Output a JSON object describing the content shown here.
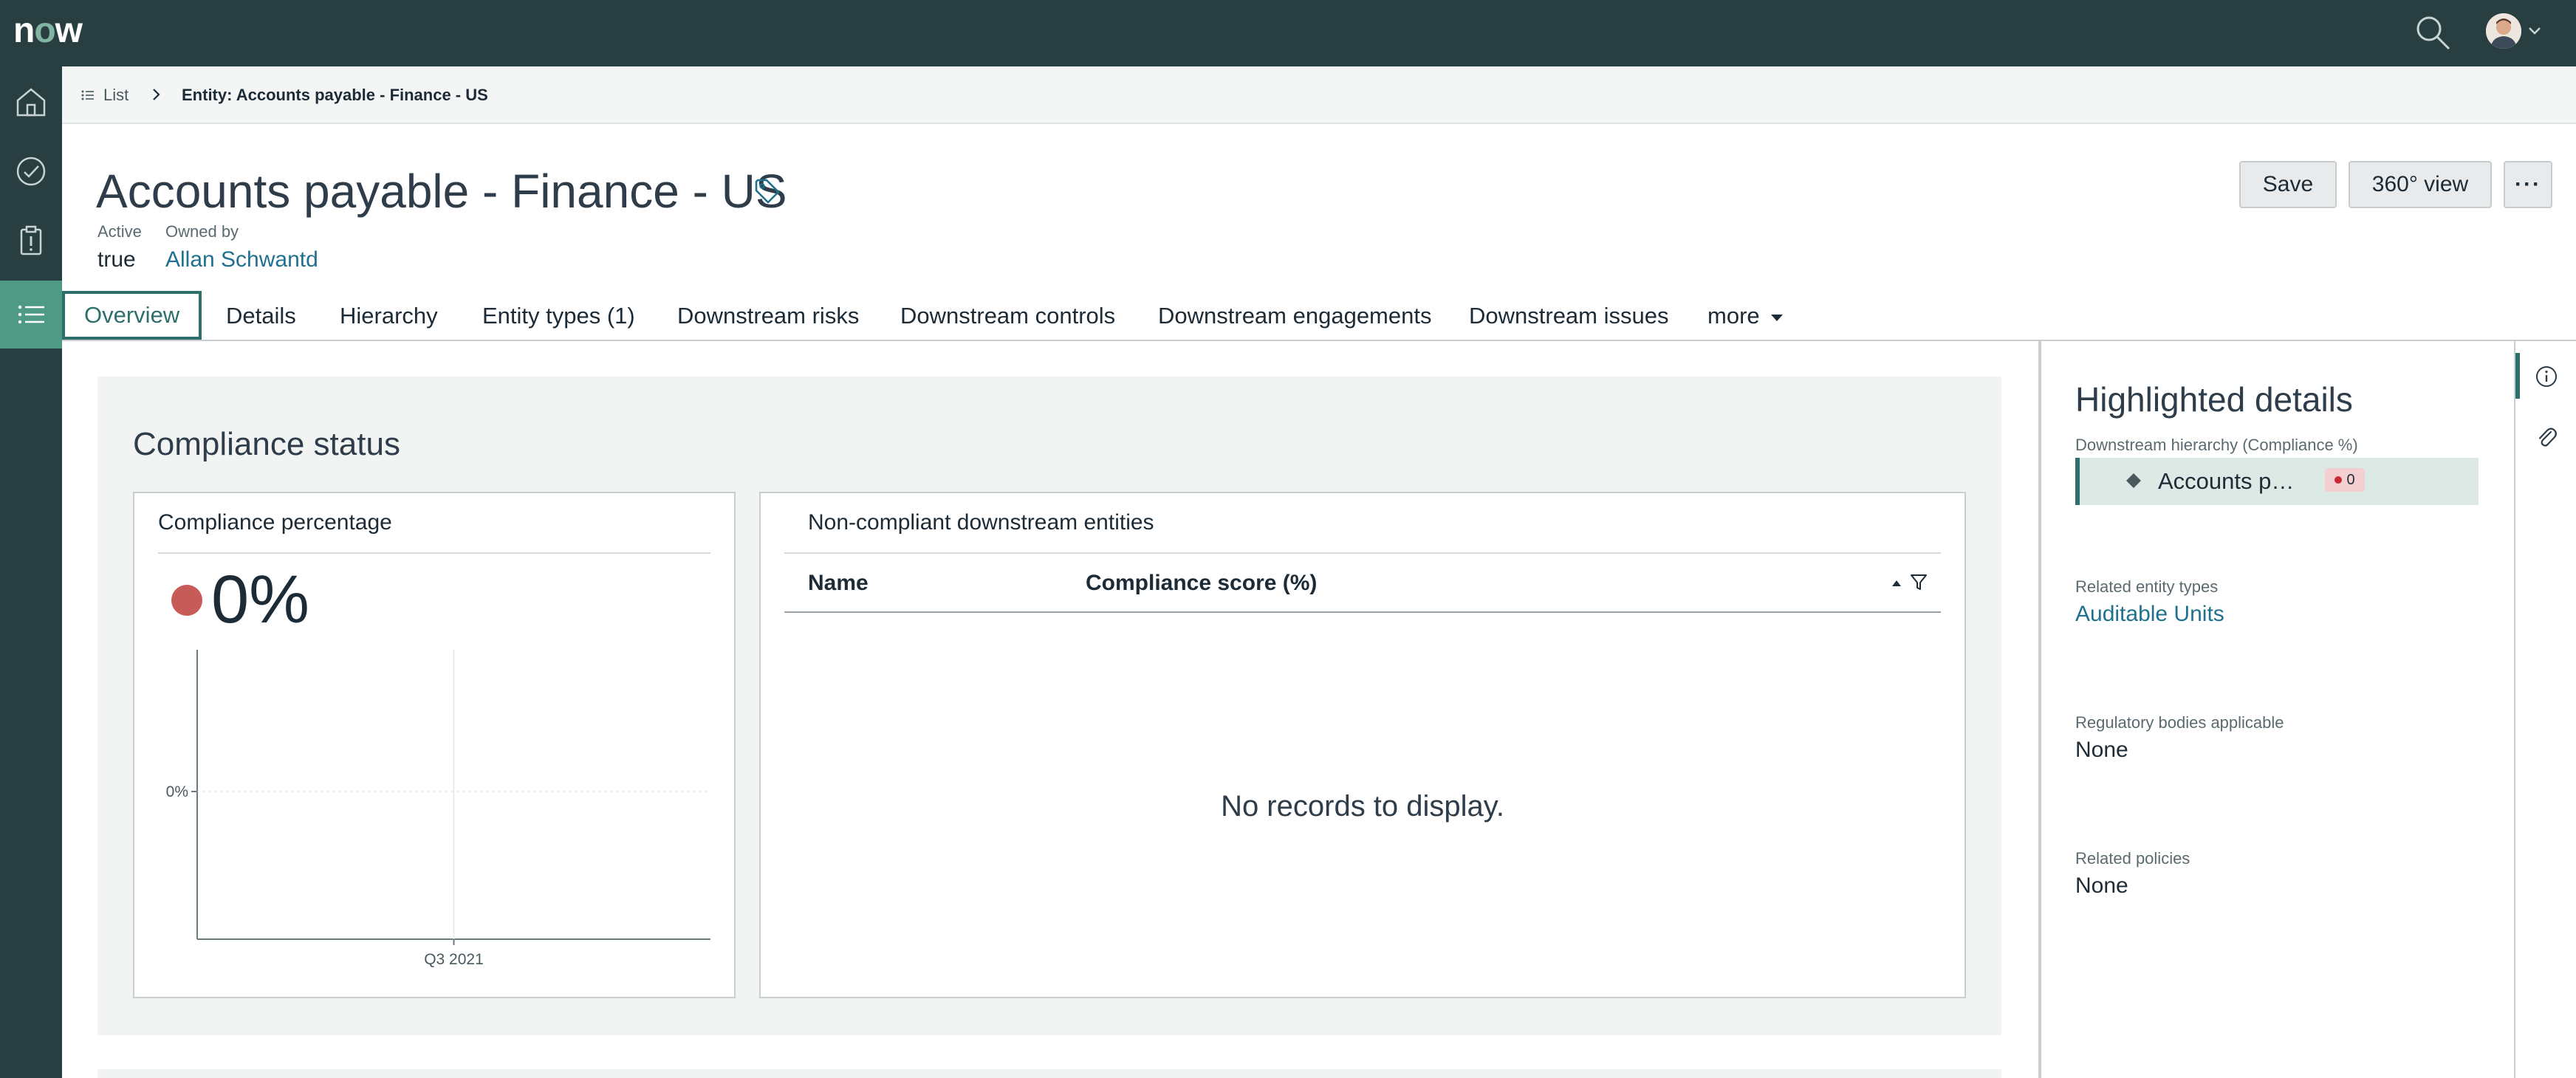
{
  "brand": {
    "logo_left": "n",
    "logo_o": "o",
    "logo_right": "w"
  },
  "topbar": {
    "search_icon": "search-icon",
    "avatar": "user-avatar"
  },
  "rail": {
    "items": [
      {
        "name": "home",
        "icon": "home-icon"
      },
      {
        "name": "approvals",
        "icon": "check-circle-icon"
      },
      {
        "name": "tasks",
        "icon": "clipboard-alert-icon"
      },
      {
        "name": "list",
        "icon": "list-icon",
        "active": true
      }
    ]
  },
  "breadcrumb": {
    "list_label": "List",
    "current": "Entity: Accounts payable - Finance - US"
  },
  "header": {
    "title": "Accounts payable - Finance - US",
    "active_label": "Active",
    "active_value": "true",
    "owned_by_label": "Owned by",
    "owned_by_value": "Allan Schwantd"
  },
  "actions": {
    "save": "Save",
    "view360": "360° view",
    "more": "···"
  },
  "tabs": [
    {
      "label": "Overview",
      "active": true
    },
    {
      "label": "Details"
    },
    {
      "label": "Hierarchy"
    },
    {
      "label": "Entity types (1)"
    },
    {
      "label": "Downstream risks"
    },
    {
      "label": "Downstream controls"
    },
    {
      "label": "Downstream engagements"
    },
    {
      "label": "Downstream issues"
    },
    {
      "label": "more"
    }
  ],
  "compliance": {
    "section_title": "Compliance status",
    "percentage_card_title": "Compliance percentage",
    "percentage_value": "0%",
    "status_color": "#c75b58",
    "chart_data": {
      "type": "line",
      "categories": [
        "Q3 2021"
      ],
      "values": [
        0
      ],
      "title": "",
      "xlabel": "",
      "ylabel": "",
      "y_tick_labels": [
        "0%"
      ]
    }
  },
  "noncompliant": {
    "card_title": "Non-compliant downstream entities",
    "columns": [
      "Name",
      "Compliance score (%)"
    ],
    "rows": [],
    "empty_message": "No records to display."
  },
  "details": {
    "title": "Highlighted details",
    "hierarchy_label": "Downstream hierarchy (Compliance %)",
    "hierarchy_item": "Accounts p…",
    "hierarchy_badge": "0",
    "related_entity_types_label": "Related entity types",
    "related_entity_types_value": "Auditable Units",
    "regulatory_label": "Regulatory bodies applicable",
    "regulatory_value": "None",
    "policies_label": "Related policies",
    "policies_value": "None"
  },
  "colors": {
    "chrome": "#293e40",
    "accent": "#4e9a84",
    "link": "#20718f",
    "danger": "#c92b33"
  }
}
